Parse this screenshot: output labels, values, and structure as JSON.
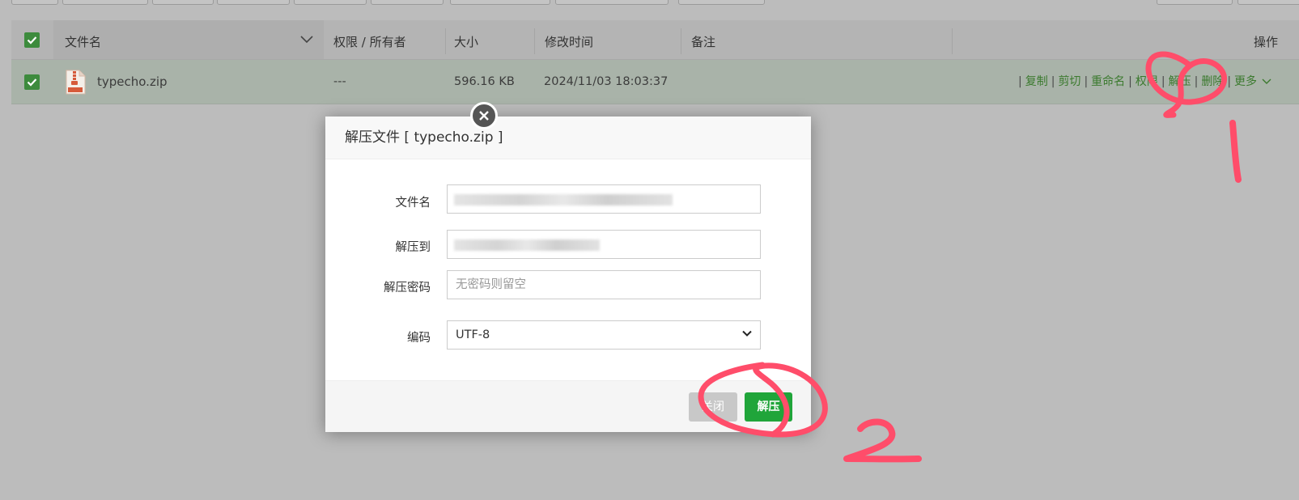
{
  "table": {
    "headers": {
      "name": "文件名",
      "permission": "权限 / 所有者",
      "size": "大小",
      "modified": "修改时间",
      "remark": "备注",
      "actions": "操作"
    },
    "rows": [
      {
        "name": "typecho.zip",
        "permission": "---",
        "size": "596.16 KB",
        "modified": "2024/11/03 18:03:37",
        "remark": ""
      }
    ],
    "row_actions": {
      "copy": "复制",
      "cut": "剪切",
      "rename": "重命名",
      "permission": "权限",
      "unzip": "解压",
      "delete": "删除",
      "more": "更多"
    }
  },
  "modal": {
    "title": "解压文件 [ typecho.zip ]",
    "fields": {
      "filename_label": "文件名",
      "extract_to_label": "解压到",
      "password_label": "解压密码",
      "password_placeholder": "无密码则留空",
      "encoding_label": "编码",
      "encoding_value": "UTF-8"
    },
    "buttons": {
      "close": "关闭",
      "unzip": "解压"
    }
  },
  "colors": {
    "accent_green": "#20a53a",
    "link_green": "#3b7a2e",
    "annotation_red": "#ff4d6a"
  }
}
